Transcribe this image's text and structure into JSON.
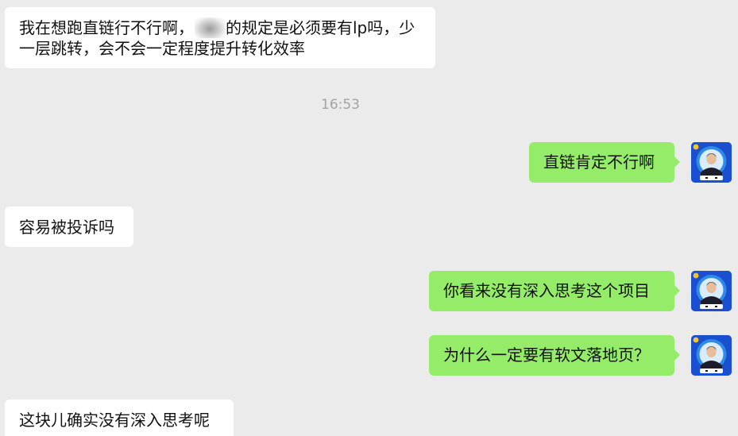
{
  "chat": {
    "messages": [
      {
        "id": "m1",
        "direction": "incoming",
        "text_before": "我在想跑直链行不行啊，",
        "text_after": "的规定是必须要有lp吗，少一层跳转，会不会一定程度提升转化效率",
        "redacted": true
      },
      {
        "id": "m2",
        "direction": "outgoing",
        "text": "直链肯定不行啊"
      },
      {
        "id": "m3",
        "direction": "incoming",
        "text": "容易被投诉吗"
      },
      {
        "id": "m4",
        "direction": "outgoing",
        "text": "你看来没有深入思考这个项目"
      },
      {
        "id": "m5",
        "direction": "outgoing",
        "text": "为什么一定要有软文落地页？"
      },
      {
        "id": "m6",
        "direction": "incoming",
        "text": "这块儿确实没有深入思考呢"
      }
    ],
    "timestamp": "16:53"
  },
  "colors": {
    "background": "#ebebeb",
    "incoming_bubble": "#ffffff",
    "outgoing_bubble": "#95ec69",
    "timestamp_text": "#a3a3a3",
    "avatar_background": "#1a4fcf"
  },
  "icons": {
    "avatar": "user-avatar-icon"
  }
}
